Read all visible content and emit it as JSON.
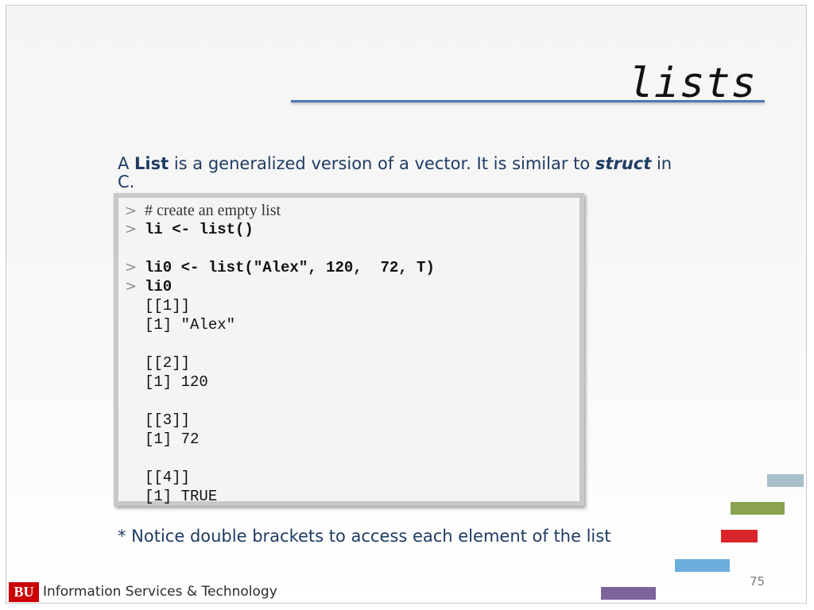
{
  "slide": {
    "title": "lists",
    "intro": {
      "part1": "A ",
      "bold1": "List",
      "part2": " is a generalized version of a vector.  It is similar to ",
      "bold2": "struct",
      "part3": " in C."
    },
    "prompt_symbol": ">",
    "code_lines": {
      "l1": "# create an empty list",
      "l2": "li <- list()",
      "l3": "li0 <- list(\"Alex\", 120,  72, T)",
      "l4": "li0",
      "o1": "[[1]]",
      "o2": "[1] \"Alex\"",
      "o3": "[[2]]",
      "o4": "[1] 120",
      "o5": "[[3]]",
      "o6": "[1] 72",
      "o7": "[[4]]",
      "o8": "[1] TRUE"
    },
    "note": "* Notice double brackets to access each element of the list",
    "page_number": "75"
  },
  "footer": {
    "logo_text": "BU",
    "org_name": "Information Services & Technology"
  },
  "colors": {
    "accent_line": "#4a79b0",
    "text_blue": "#1f3b63",
    "logo_red": "#cc0000",
    "bar_lightblue": "#a9bfcc",
    "bar_green": "#8aa351",
    "bar_red": "#d9252b",
    "bar_blue": "#6aaede",
    "bar_purple": "#7d6399"
  }
}
